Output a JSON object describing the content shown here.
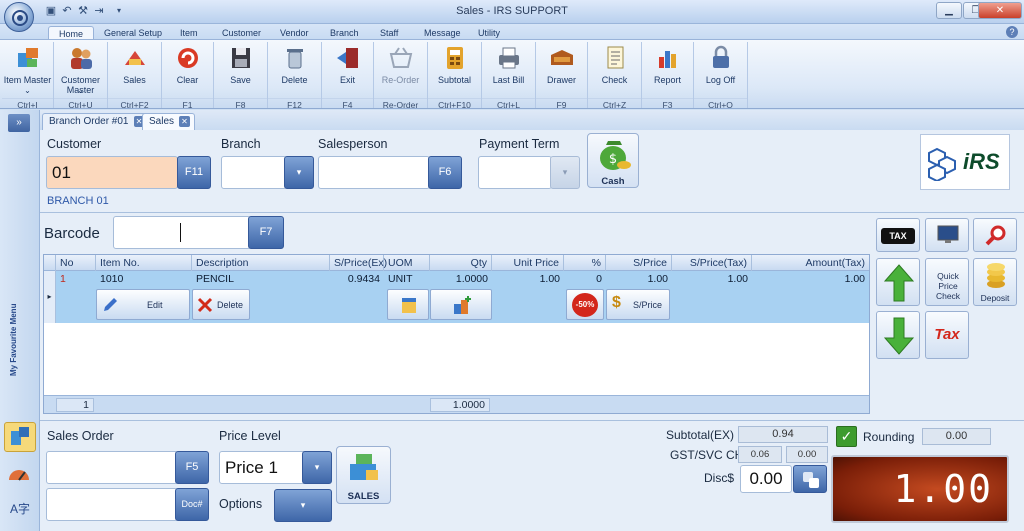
{
  "window": {
    "title": "Sales - IRS SUPPORT"
  },
  "ribbon_tabs": [
    "Home",
    "General Setup",
    "Item",
    "Customer",
    "Vendor",
    "Branch",
    "Staff",
    "Message",
    "Utility"
  ],
  "ribbon_buttons": [
    {
      "label": "Item Master",
      "key": "Ctrl+I",
      "icon": "box-icon"
    },
    {
      "label": "Customer Master",
      "key": "Ctrl+U",
      "icon": "people-icon"
    },
    {
      "label": "Sales",
      "key": "Ctrl+F2",
      "icon": "sales-icon"
    },
    {
      "label": "Clear",
      "key": "F1",
      "icon": "clear-icon"
    },
    {
      "label": "Save",
      "key": "F8",
      "icon": "save-icon"
    },
    {
      "label": "Delete",
      "key": "F12",
      "icon": "trash-icon"
    },
    {
      "label": "Exit",
      "key": "F4",
      "icon": "exit-icon"
    },
    {
      "label": "Re-Order",
      "key": "Re-Order",
      "icon": "basket-icon"
    },
    {
      "label": "Subtotal",
      "key": "Ctrl+F10",
      "icon": "calculator-icon"
    },
    {
      "label": "Last Bill",
      "key": "Ctrl+L",
      "icon": "printer-icon"
    },
    {
      "label": "Drawer",
      "key": "F9",
      "icon": "drawer-icon"
    },
    {
      "label": "Check",
      "key": "Ctrl+Z",
      "icon": "checklist-icon"
    },
    {
      "label": "Report",
      "key": "F3",
      "icon": "report-icon"
    },
    {
      "label": "Log Off",
      "key": "Ctrl+O",
      "icon": "lock-icon"
    }
  ],
  "sidebar": {
    "label": "My Favourite Menu"
  },
  "doc_tabs": [
    "Branch Order #01",
    "Sales"
  ],
  "form": {
    "customer_label": "Customer",
    "customer_value": "01",
    "customer_btn": "F11",
    "branch_name": "BRANCH 01",
    "branch_label": "Branch",
    "salesperson_label": "Salesperson",
    "salesperson_btn": "F6",
    "payment_label": "Payment Term",
    "cash_label": "Cash",
    "barcode_label": "Barcode",
    "barcode_btn": "F7",
    "logo_text": "iRS"
  },
  "grid": {
    "columns": [
      "No",
      "Item No.",
      "Description",
      "S/Price(Ex)",
      "UOM",
      "Qty",
      "Unit Price",
      "%",
      "S/Price",
      "S/Price(Tax)",
      "Amount(Tax)"
    ],
    "rows": [
      {
        "no": "1",
        "item": "1010",
        "desc": "PENCIL",
        "sprice_ex": "0.9434",
        "uom": "UNIT",
        "qty": "1.0000",
        "unit_price": "1.00",
        "pct": "0",
        "sprice": "1.00",
        "sprice_tax": "1.00",
        "amount_tax": "1.00"
      }
    ],
    "edit_label": "Edit",
    "delete_label": "Delete",
    "discount_badge": "-50%",
    "sprice_btn": "S/Price",
    "footer_count": "1",
    "footer_qty": "1.0000"
  },
  "right_panel": {
    "quick_price": "Quick Price Check",
    "deposit": "Deposit",
    "tax_badge": "TAX",
    "tax_label": "Tax"
  },
  "bottom": {
    "sales_order_label": "Sales Order",
    "sales_order_btn": "F5",
    "doc_btn": "Doc#",
    "price_level_label": "Price Level",
    "price_level_value": "Price 1",
    "options_label": "Options",
    "sales_btn": "SALES"
  },
  "totals": {
    "subtotal_label": "Subtotal(EX)",
    "subtotal": "0.94",
    "gst_label": "GST/SVC CHG",
    "gst": "0.06",
    "svc": "0.00",
    "disc_label": "Disc$",
    "disc": "0.00",
    "rounding_label": "Rounding",
    "rounding": "0.00",
    "display": "1.00"
  },
  "colors": {
    "accent": "#3e66a8",
    "display_bg": "#b53a16",
    "customer_field": "#fbd8bd",
    "row_highlight": "#a8d1f2"
  }
}
